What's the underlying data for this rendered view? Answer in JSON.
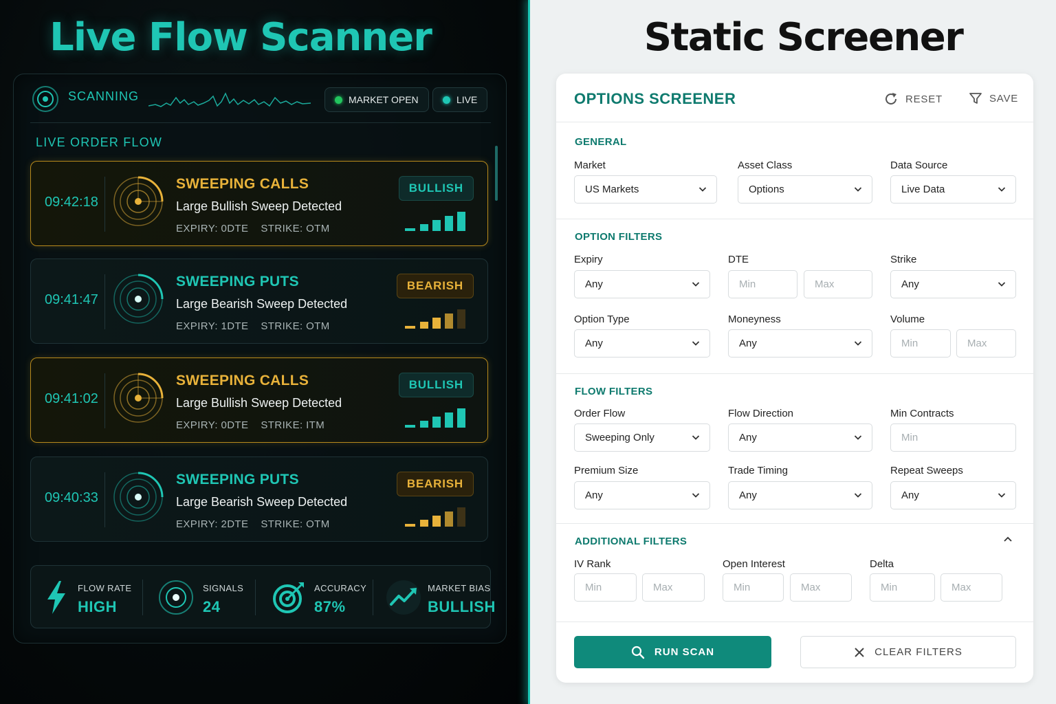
{
  "left": {
    "title": "Live Flow Scanner",
    "status_label": "SCANNING",
    "market_pill": "MARKET OPEN",
    "live_pill": "LIVE",
    "section_title": "LIVE ORDER FLOW",
    "cards": [
      {
        "time": "09:42:18",
        "title": "SWEEPING CALLS",
        "subtitle": "Large Bullish Sweep Detected",
        "expiry": "EXPIRY: 0DTE",
        "strike": "STRIKE:  OTM",
        "badge": "BULLISH"
      },
      {
        "time": "09:41:47",
        "title": "SWEEPING PUTS",
        "subtitle": "Large Bearish Sweep Detected",
        "expiry": "EXPIRY: 1DTE",
        "strike": "STRIKE:  OTM",
        "badge": "BEARISH"
      },
      {
        "time": "09:41:02",
        "title": "SWEEPING CALLS",
        "subtitle": "Large Bullish Sweep Detected",
        "expiry": "EXPIRY: 0DTE",
        "strike": "STRIKE:  ITM",
        "badge": "BULLISH"
      },
      {
        "time": "09:40:33",
        "title": "SWEEPING PUTS",
        "subtitle": "Large Bearish Sweep Detected",
        "expiry": "EXPIRY: 2DTE",
        "strike": "STRIKE:  OTM",
        "badge": "BEARISH"
      }
    ],
    "stats": [
      {
        "label": "FLOW RATE",
        "value": "HIGH",
        "icon": "lightning-icon"
      },
      {
        "label": "SIGNALS",
        "value": "24",
        "icon": "radar-icon"
      },
      {
        "label": "ACCURACY",
        "value": "87%",
        "icon": "target-icon"
      },
      {
        "label": "MARKET BIAS",
        "value": "BULLISH",
        "icon": "trend-up-icon"
      }
    ]
  },
  "right": {
    "title": "Static Screener",
    "panel_title": "OPTIONS SCREENER",
    "reset_label": "RESET",
    "save_label": "SAVE",
    "general": {
      "title": "GENERAL",
      "market": {
        "label": "Market",
        "value": "US Markets"
      },
      "asset_class": {
        "label": "Asset Class",
        "value": "Options"
      },
      "data_source": {
        "label": "Data Source",
        "value": "Live Data"
      }
    },
    "option_filters": {
      "title": "OPTION FILTERS",
      "expiry": {
        "label": "Expiry",
        "value": "Any"
      },
      "dte": {
        "label": "DTE",
        "min": "Min",
        "max": "Max"
      },
      "strike": {
        "label": "Strike",
        "value": "Any"
      },
      "option_type": {
        "label": "Option Type",
        "value": "Any"
      },
      "moneyness": {
        "label": "Moneyness",
        "value": "Any"
      },
      "volume": {
        "label": "Volume",
        "min": "Min",
        "max": "Max"
      }
    },
    "flow_filters": {
      "title": "FLOW FILTERS",
      "order_flow": {
        "label": "Order Flow",
        "value": "Sweeping Only"
      },
      "flow_direction": {
        "label": "Flow Direction",
        "value": "Any"
      },
      "min_contracts": {
        "label": "Min Contracts",
        "placeholder": "Min"
      },
      "premium_size": {
        "label": "Premium Size",
        "value": "Any"
      },
      "trade_timing": {
        "label": "Trade Timing",
        "value": "Any"
      },
      "repeat_sweeps": {
        "label": "Repeat Sweeps",
        "value": "Any"
      }
    },
    "additional_filters": {
      "title": "ADDITIONAL FILTERS",
      "iv_rank": {
        "label": "IV Rank",
        "min": "Min",
        "max": "Max"
      },
      "open_interest": {
        "label": "Open Interest",
        "min": "Min",
        "max": "Max"
      },
      "delta": {
        "label": "Delta",
        "min": "Min",
        "max": "Max"
      }
    },
    "run_label": "RUN SCAN",
    "clear_label": "CLEAR FILTERS"
  },
  "colors": {
    "teal": "#1fc6b4",
    "gold": "#e8b23a",
    "green_button": "#0f8a7b",
    "section_teal": "#0e7a6e"
  }
}
